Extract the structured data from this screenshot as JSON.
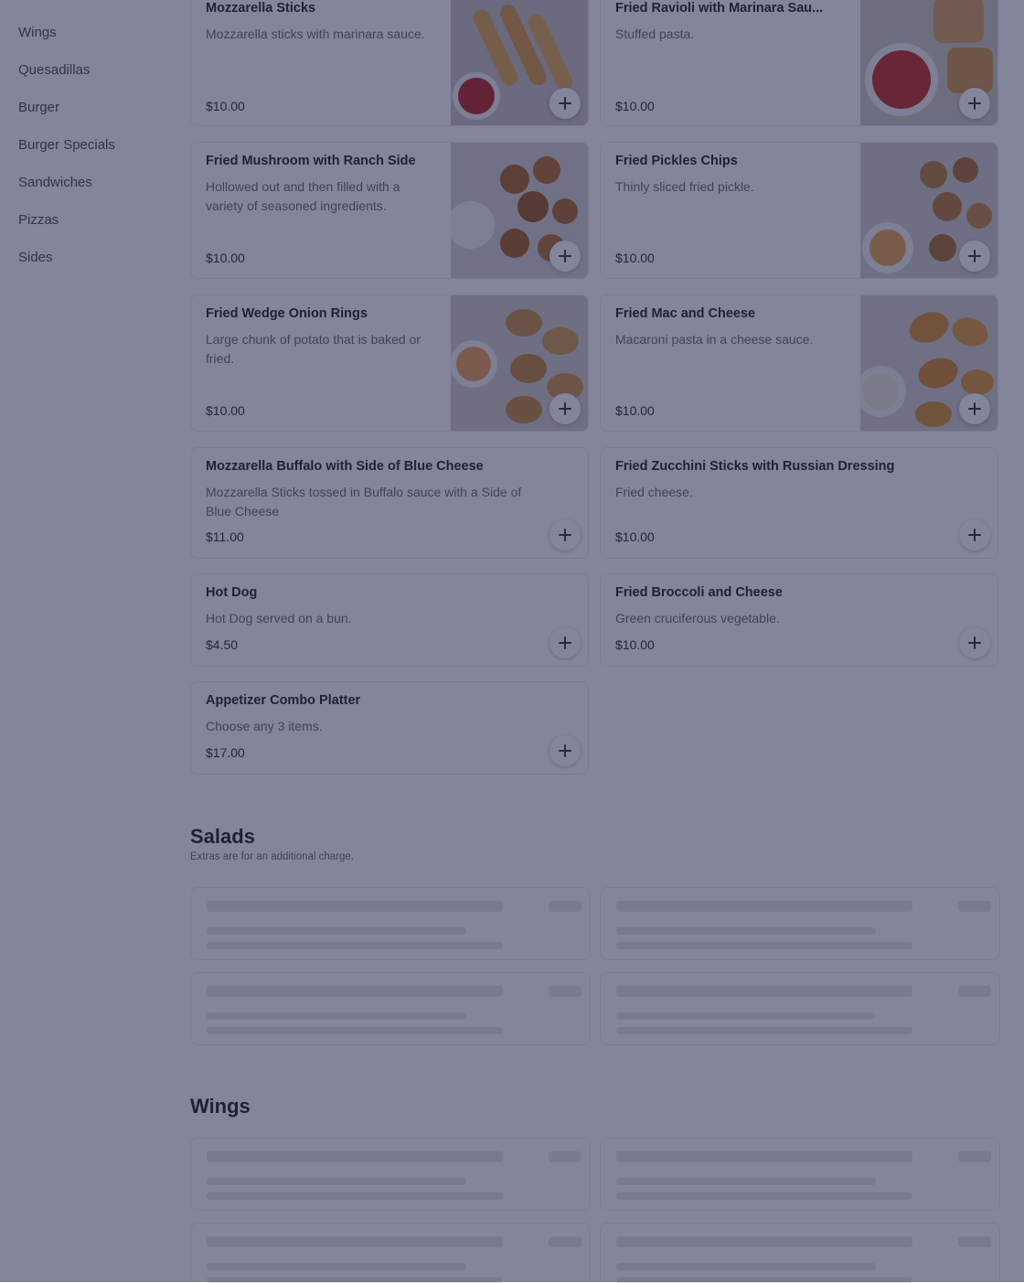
{
  "sidebar": {
    "items": [
      {
        "label": "Wings"
      },
      {
        "label": "Quesadillas"
      },
      {
        "label": "Burger"
      },
      {
        "label": "Burger Specials"
      },
      {
        "label": "Sandwiches"
      },
      {
        "label": "Pizzas"
      },
      {
        "label": "Sides"
      }
    ]
  },
  "appetizers": {
    "items": [
      {
        "name": "Mozzarella Sticks",
        "description": "Mozzarella sticks with marinara sauce.",
        "price": "$10.00",
        "image": "mozzarella-sticks-photo"
      },
      {
        "name": "Fried Ravioli with Marinara Sau...",
        "description": "Stuffed pasta.",
        "price": "$10.00",
        "image": "fried-ravioli-photo"
      },
      {
        "name": "Fried Mushroom with Ranch Side",
        "description": "Hollowed out and then filled with a variety of seasoned ingredients.",
        "price": "$10.00",
        "image": "fried-mushroom-photo"
      },
      {
        "name": "Fried Pickles Chips",
        "description": "Thinly sliced fried pickle.",
        "price": "$10.00",
        "image": "fried-pickles-photo"
      },
      {
        "name": "Fried Wedge Onion Rings",
        "description": "Large chunk of potato that is baked or fried.",
        "price": "$10.00",
        "image": "onion-rings-photo"
      },
      {
        "name": "Fried Mac and Cheese",
        "description": "Macaroni pasta in a cheese sauce.",
        "price": "$10.00",
        "image": "mac-and-cheese-photo"
      },
      {
        "name": "Mozzarella Buffalo with Side of Blue Cheese",
        "description": "Mozzarella Sticks tossed in Buffalo sauce with a Side of Blue Cheese",
        "price": "$11.00"
      },
      {
        "name": "Fried Zucchini Sticks with Russian Dressing",
        "description": "Fried cheese.",
        "price": "$10.00"
      },
      {
        "name": "Hot Dog",
        "description": "Hot Dog served on a bun.",
        "price": "$4.50"
      },
      {
        "name": "Fried Broccoli and Cheese",
        "description": "Green cruciferous vegetable.",
        "price": "$10.00"
      },
      {
        "name": "Appetizer Combo Platter",
        "description": "Choose any 3 items.",
        "price": "$17.00"
      }
    ]
  },
  "salads": {
    "title": "Salads",
    "subtitle": "Extras are for an additional charge."
  },
  "wings": {
    "title": "Wings"
  },
  "icons": {
    "add": "plus-icon"
  },
  "colors": {
    "overlay": "#1e2148",
    "skeleton": "#e6e6e6"
  }
}
